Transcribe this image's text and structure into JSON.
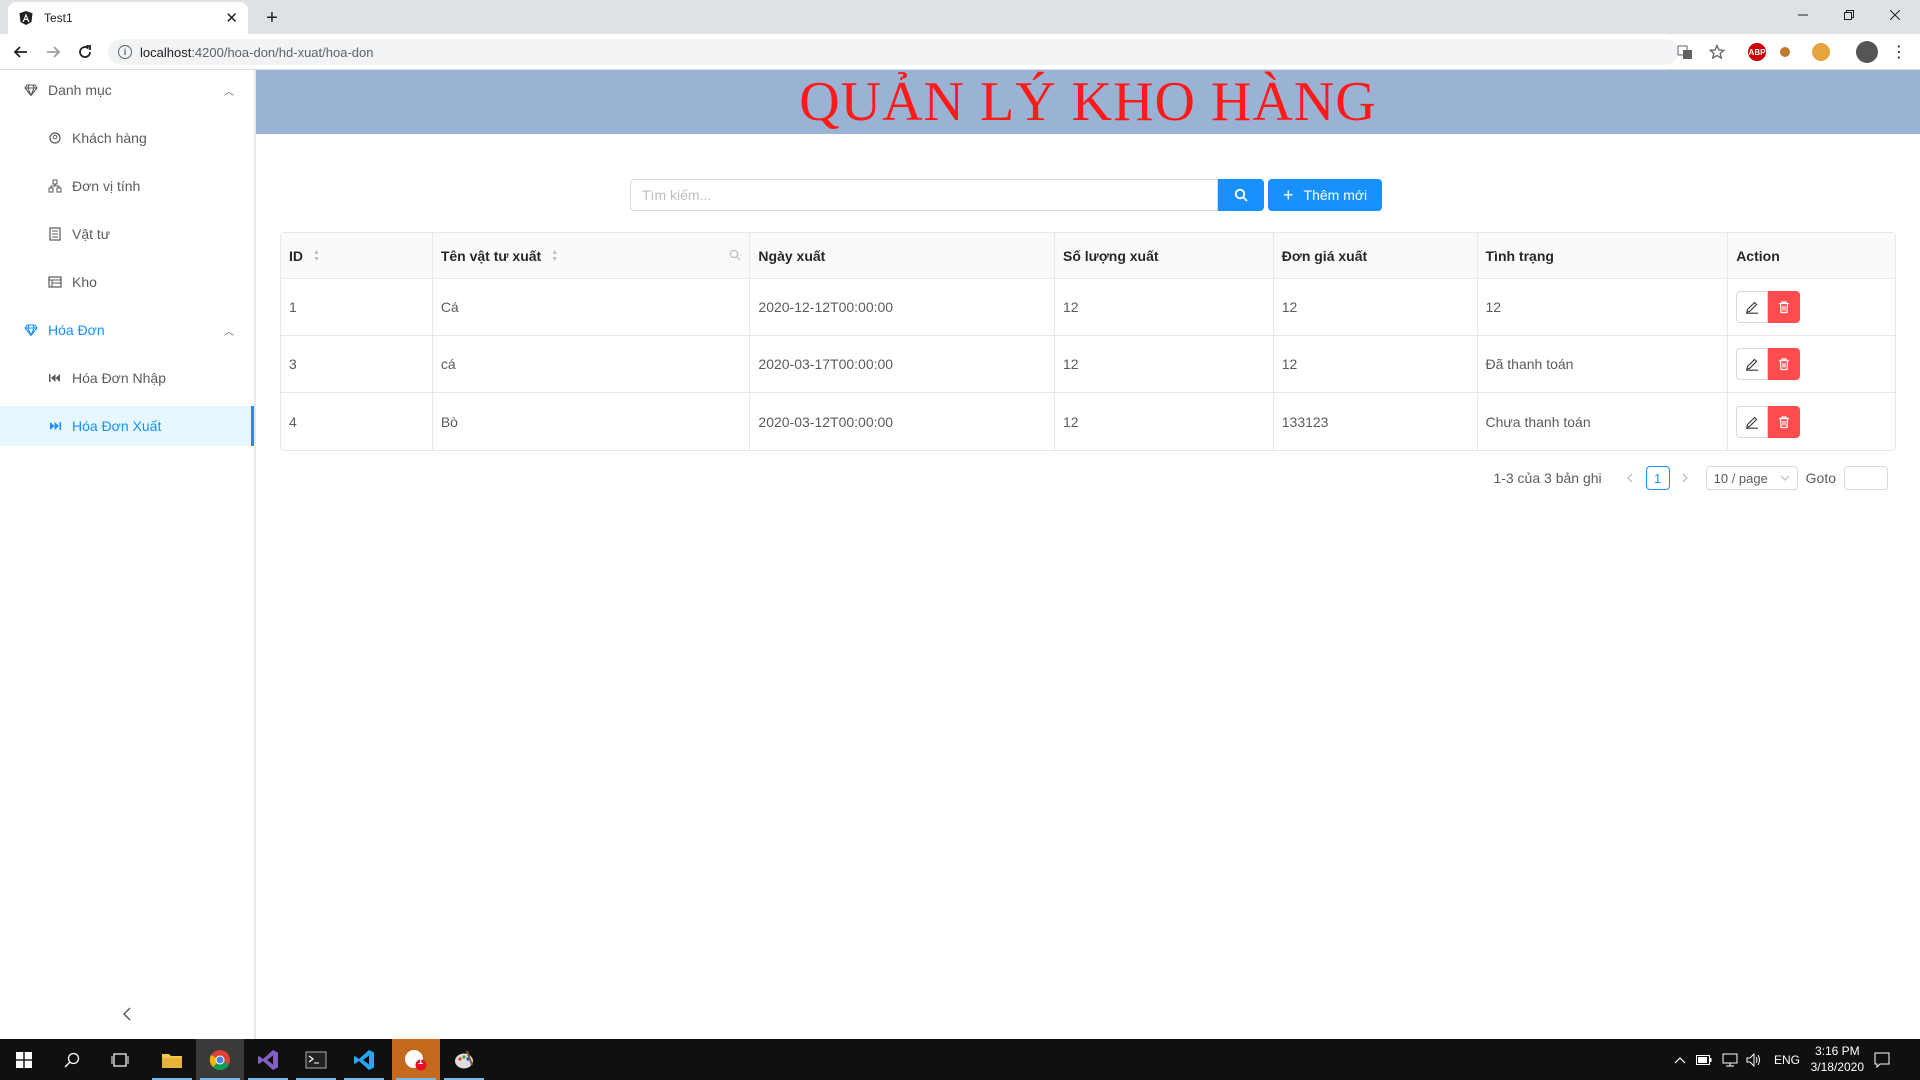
{
  "browser": {
    "tab_title": "Test1",
    "url_host": "localhost",
    "url_rest": ":4200/hoa-don/hd-xuat/hoa-don"
  },
  "sidebar": {
    "groups": [
      {
        "label": "Danh mục",
        "items": [
          {
            "label": "Khách hàng",
            "icon": "customer-icon"
          },
          {
            "label": "Đơn vị tính",
            "icon": "unit-icon"
          },
          {
            "label": "Vật tư",
            "icon": "supplies-icon"
          },
          {
            "label": "Kho",
            "icon": "warehouse-icon"
          }
        ]
      },
      {
        "label": "Hóa Đơn",
        "items": [
          {
            "label": "Hóa Đơn Nhập",
            "icon": "backward-icon"
          },
          {
            "label": "Hóa Đơn Xuất",
            "icon": "forward-icon",
            "active": true
          }
        ]
      }
    ]
  },
  "header": {
    "title": "QUẢN LÝ KHO HÀNG"
  },
  "search": {
    "placeholder": "Tìm kiếm..."
  },
  "toolbar": {
    "add_label": "Thêm mới"
  },
  "table": {
    "columns": [
      "ID",
      "Tên vật tư xuất",
      "Ngày xuất",
      "Số lượng xuất",
      "Đơn giá xuất",
      "Tình trạng",
      "Action"
    ],
    "rows": [
      {
        "id": "1",
        "name": "Cá",
        "date": "2020-12-12T00:00:00",
        "qty": "12",
        "price": "12",
        "status": "12"
      },
      {
        "id": "3",
        "name": "cá",
        "date": "2020-03-17T00:00:00",
        "qty": "12",
        "price": "12",
        "status": "Đã thanh toán"
      },
      {
        "id": "4",
        "name": "Bò",
        "date": "2020-03-12T00:00:00",
        "qty": "12",
        "price": "133123",
        "status": "Chưa thanh toán"
      }
    ]
  },
  "pagination": {
    "total_text": "1-3 của 3 bản ghi",
    "current_page": "1",
    "page_size": "10 / page",
    "goto_label": "Goto"
  },
  "taskbar": {
    "time": "3:16 PM",
    "date": "3/18/2020",
    "lang": "ENG",
    "badge": "1"
  },
  "colors": {
    "accent": "#1890ff",
    "danger": "#ff4d4f",
    "banner_bg": "#9ab3d5",
    "banner_text": "#ff1a1a"
  }
}
